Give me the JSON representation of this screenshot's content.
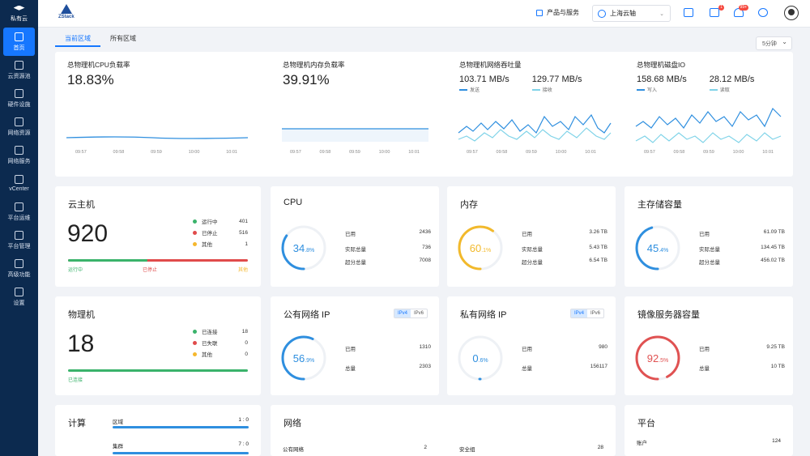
{
  "sidebar": {
    "brand": "私有云",
    "items": [
      {
        "label": "首页",
        "icon": "home-icon",
        "active": true
      },
      {
        "label": "云资源池",
        "icon": "cloud-icon"
      },
      {
        "label": "硬件设施",
        "icon": "server-icon"
      },
      {
        "label": "网络资源",
        "icon": "network-icon"
      },
      {
        "label": "网络服务",
        "icon": "service-icon"
      },
      {
        "label": "vCenter",
        "icon": "vcenter-icon"
      },
      {
        "label": "平台运维",
        "icon": "monitor-icon"
      },
      {
        "label": "平台管理",
        "icon": "admin-icon"
      },
      {
        "label": "高级功能",
        "icon": "advanced-icon"
      },
      {
        "label": "设置",
        "icon": "gear-icon"
      }
    ]
  },
  "topbar": {
    "logo": "ZStack",
    "products": "产品与服务",
    "region": "上海云轴",
    "notify_badge": "1",
    "alert_badge": "99+"
  },
  "tabs": [
    "当前区域",
    "所有区域"
  ],
  "refresh": "5分钟",
  "metrics": [
    {
      "title": "总物理机CPU负载率",
      "value": "18.83%",
      "ticks": [
        "09:57",
        "09:58",
        "09:59",
        "10:00",
        "10:01"
      ]
    },
    {
      "title": "总物理机内存负载率",
      "value": "39.91%",
      "ticks": [
        "09:57",
        "09:58",
        "09:59",
        "10:00",
        "10:01"
      ]
    },
    {
      "title": "总物理机网络吞吐量",
      "v1": "103.71 MB/s",
      "l1": "发送",
      "v2": "129.77 MB/s",
      "l2": "接收",
      "ticks": [
        "09:57",
        "09:58",
        "09:59",
        "10:00",
        "10:01"
      ]
    },
    {
      "title": "总物理机磁盘IO",
      "v1": "158.68 MB/s",
      "l1": "写入",
      "v2": "28.12 MB/s",
      "l2": "读取",
      "ticks": [
        "09:57",
        "09:58",
        "09:59",
        "10:00",
        "10:01"
      ]
    }
  ],
  "vm": {
    "title": "云主机",
    "count": "920",
    "legend": [
      {
        "label": "运行中",
        "value": "401",
        "color": "#3ab36b"
      },
      {
        "label": "已停止",
        "value": "516",
        "color": "#e04b4b"
      },
      {
        "label": "其他",
        "value": "1",
        "color": "#f5b72d"
      }
    ],
    "bar_labels": [
      "运行中",
      "已停止",
      "其他"
    ],
    "running_ratio": 0.44
  },
  "cpu": {
    "title": "CPU",
    "percent": 34.8,
    "int": "34",
    "dec": ".8%",
    "color": "#2f8fdf",
    "rows": [
      {
        "k": "已用",
        "v": "2436"
      },
      {
        "k": "实际总量",
        "v": "736"
      },
      {
        "k": "超分总量",
        "v": "7008"
      }
    ]
  },
  "mem": {
    "title": "内存",
    "percent": 60.1,
    "int": "60",
    "dec": ".1%",
    "color": "#f2b92b",
    "rows": [
      {
        "k": "已用",
        "v": "3.26 TB"
      },
      {
        "k": "实际总量",
        "v": "5.43 TB"
      },
      {
        "k": "超分总量",
        "v": "6.54 TB"
      }
    ]
  },
  "storage": {
    "title": "主存储容量",
    "percent": 45.4,
    "int": "45",
    "dec": ".4%",
    "color": "#2f8fdf",
    "rows": [
      {
        "k": "已用",
        "v": "61.09 TB"
      },
      {
        "k": "实际总量",
        "v": "134.45 TB"
      },
      {
        "k": "超分总量",
        "v": "456.02 TB"
      }
    ]
  },
  "host": {
    "title": "物理机",
    "count": "18",
    "legend": [
      {
        "label": "已连接",
        "value": "18",
        "color": "#3ab36b"
      },
      {
        "label": "已失联",
        "value": "0",
        "color": "#e04b4b"
      },
      {
        "label": "其他",
        "value": "0",
        "color": "#f5b72d"
      }
    ],
    "bar_label": "已连接"
  },
  "pubip": {
    "title": "公有网络 IP",
    "percent": 56.9,
    "int": "56",
    "dec": ".9%",
    "color": "#2f8fdf",
    "toggle": [
      "IPv4",
      "IPv6"
    ],
    "rows": [
      {
        "k": "已用",
        "v": "1310"
      },
      {
        "k": "总量",
        "v": "2303"
      }
    ]
  },
  "privip": {
    "title": "私有网络 IP",
    "percent": 0.6,
    "int": "0",
    "dec": ".6%",
    "color": "#2f8fdf",
    "toggle": [
      "IPv4",
      "IPv6"
    ],
    "rows": [
      {
        "k": "已用",
        "v": "980"
      },
      {
        "k": "总量",
        "v": "156117"
      }
    ]
  },
  "image": {
    "title": "镜像服务器容量",
    "percent": 92.5,
    "int": "92",
    "dec": ".5%",
    "color": "#e05252",
    "rows": [
      {
        "k": "已用",
        "v": "9.25 TB"
      },
      {
        "k": "总量",
        "v": "10 TB"
      }
    ]
  },
  "compute": {
    "title": "计算",
    "rows": [
      {
        "k": "区域",
        "v": "1 : 0"
      },
      {
        "k": "集群",
        "v": "7 : 0"
      }
    ]
  },
  "network": {
    "title": "网络",
    "rows": [
      {
        "k": "公有网络",
        "v": "2"
      },
      {
        "k": "安全组",
        "v": "28"
      }
    ]
  },
  "platform": {
    "title": "平台",
    "rows": [
      {
        "k": "账户",
        "v": "124"
      }
    ]
  }
}
